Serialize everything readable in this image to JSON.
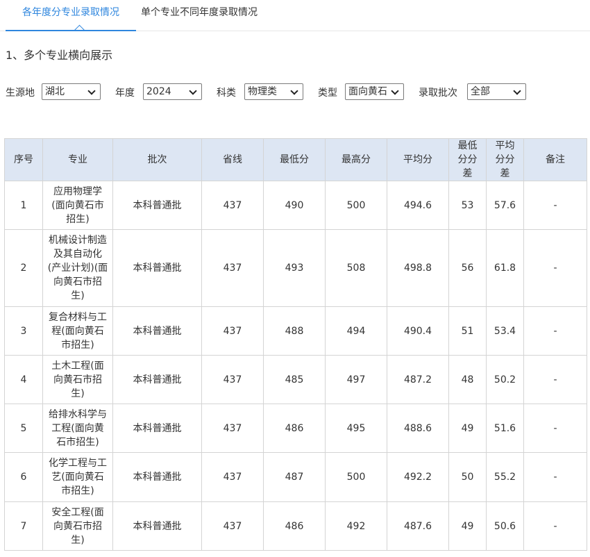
{
  "tabs": [
    {
      "label": "各年度分专业录取情况",
      "active": true
    },
    {
      "label": "单个专业不同年度录取情况",
      "active": false
    }
  ],
  "section_title": "1、多个专业横向展示",
  "filters": {
    "region": {
      "label": "生源地",
      "value": "湖北"
    },
    "year": {
      "label": "年度",
      "value": "2024"
    },
    "subject": {
      "label": "科类",
      "value": "物理类"
    },
    "type": {
      "label": "类型",
      "value": "面向黄石"
    },
    "batch": {
      "label": "录取批次",
      "value": "全部"
    }
  },
  "table": {
    "headers": {
      "index": "序号",
      "major": "专业",
      "batch": "批次",
      "province_line": "省线",
      "min_score": "最低分",
      "max_score": "最高分",
      "avg_score": "平均分",
      "min_diff": "最低分分差",
      "avg_diff": "平均分分差",
      "note": "备注"
    },
    "rows": [
      {
        "index": "1",
        "major": "应用物理学(面向黄石市招生)",
        "batch": "本科普通批",
        "province_line": "437",
        "min_score": "490",
        "max_score": "500",
        "avg_score": "494.6",
        "min_diff": "53",
        "avg_diff": "57.6",
        "note": "-"
      },
      {
        "index": "2",
        "major": "机械设计制造及其自动化(产业计划)(面向黄石市招生)",
        "batch": "本科普通批",
        "province_line": "437",
        "min_score": "493",
        "max_score": "508",
        "avg_score": "498.8",
        "min_diff": "56",
        "avg_diff": "61.8",
        "note": "-"
      },
      {
        "index": "3",
        "major": "复合材料与工程(面向黄石市招生)",
        "batch": "本科普通批",
        "province_line": "437",
        "min_score": "488",
        "max_score": "494",
        "avg_score": "490.4",
        "min_diff": "51",
        "avg_diff": "53.4",
        "note": "-"
      },
      {
        "index": "4",
        "major": "土木工程(面向黄石市招生)",
        "batch": "本科普通批",
        "province_line": "437",
        "min_score": "485",
        "max_score": "497",
        "avg_score": "487.2",
        "min_diff": "48",
        "avg_diff": "50.2",
        "note": "-"
      },
      {
        "index": "5",
        "major": "给排水科学与工程(面向黄石市招生)",
        "batch": "本科普通批",
        "province_line": "437",
        "min_score": "486",
        "max_score": "495",
        "avg_score": "488.6",
        "min_diff": "49",
        "avg_diff": "51.6",
        "note": "-"
      },
      {
        "index": "6",
        "major": "化学工程与工艺(面向黄石市招生)",
        "batch": "本科普通批",
        "province_line": "437",
        "min_score": "487",
        "max_score": "500",
        "avg_score": "492.2",
        "min_diff": "50",
        "avg_diff": "55.2",
        "note": "-"
      },
      {
        "index": "7",
        "major": "安全工程(面向黄石市招生)",
        "batch": "本科普通批",
        "province_line": "437",
        "min_score": "486",
        "max_score": "492",
        "avg_score": "487.6",
        "min_diff": "49",
        "avg_diff": "50.6",
        "note": "-"
      }
    ]
  }
}
